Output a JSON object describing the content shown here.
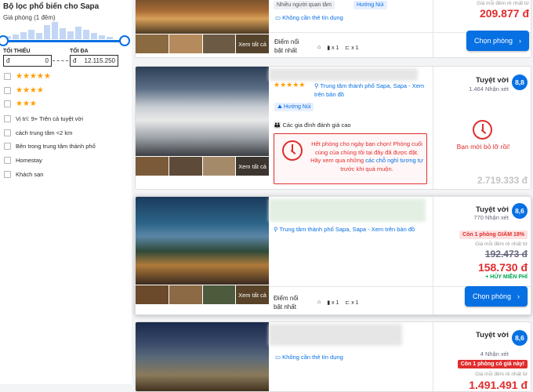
{
  "sidebar": {
    "title": "Bộ lọc phổ biến cho Sapa",
    "subtitle": "Giá phòng (1 đêm)",
    "min_label": "TỐI THIỂU",
    "max_label": "TỐI ĐA",
    "currency": "đ",
    "min_value": "0",
    "max_value": "12.115.250",
    "filters": [
      {
        "label": "★★★★★",
        "type": "stars"
      },
      {
        "label": "★★★★",
        "type": "stars"
      },
      {
        "label": "★★★",
        "type": "stars"
      },
      {
        "label": "Vị trí: 9+ Trên cả tuyệt vời",
        "type": "text"
      },
      {
        "label": "cách trung tâm <2 km",
        "type": "text"
      },
      {
        "label": "Bên trong trung tâm thành phố",
        "type": "text"
      },
      {
        "label": "Homestay",
        "type": "text"
      },
      {
        "label": "Khách sạn",
        "type": "text"
      }
    ]
  },
  "common": {
    "see_all": "Xem tất cả",
    "no_credit_card": "Không cần thẻ tín dụng",
    "highlights_label": "Điểm nổi\nbật nhất",
    "select_room": "Chọn phòng",
    "lowest_price_note": "Giá mỗi đêm rẻ nhất từ",
    "currency": "đ",
    "amenity_bed": "x 1",
    "amenity_bath": "x 1"
  },
  "card1": {
    "tag_top": "Nhiều người quan tâm",
    "tag_type": "Hướng Núi",
    "price": "209.877"
  },
  "card2": {
    "stars": "★★★★★",
    "location": "Trung tâm thành phố Sapa, Sapa - Xem trên bản đồ",
    "tag_type": "Hướng Núi",
    "family": "Các gia đình đánh giá cao",
    "sold_out": "Hết phòng cho ngày bạn chọn! Phòng cuối cùng của chúng tôi tại đây đã được đặt. Hãy xem qua những",
    "sold_out_link": "các chỗ nghỉ tương tự",
    "sold_out_tail": "trước khi quá muộn.",
    "rating": "Tuyệt vời",
    "reviews": "1.464 Nhận xét",
    "score": "8,8",
    "missed": "Bạn mới bỏ lỡ rồi!",
    "old_price": "2.719.333"
  },
  "card3": {
    "location": "Trung tâm thành phố Sapa, Sapa - Xem trên bản đồ",
    "rating": "Tuyệt vời",
    "reviews": "770 Nhận xét",
    "score": "8,6",
    "deal": "Còn 1 phòng GIẢM 18%",
    "old_price": "192.473",
    "price": "158.730",
    "free_cancel": "+ HỦY MIỄN PHÍ"
  },
  "card4": {
    "rating": "Tuyệt vời",
    "reviews": "4 Nhận xét",
    "score": "8,6",
    "deal": "Còn 1 phòng có giá này!",
    "lowest": "Giá mỗi đêm rẻ nhất từ",
    "price": "1.491.491"
  },
  "colors": {
    "accent": "#0770e3",
    "price": "#e12d2d",
    "free": "#00a651"
  }
}
